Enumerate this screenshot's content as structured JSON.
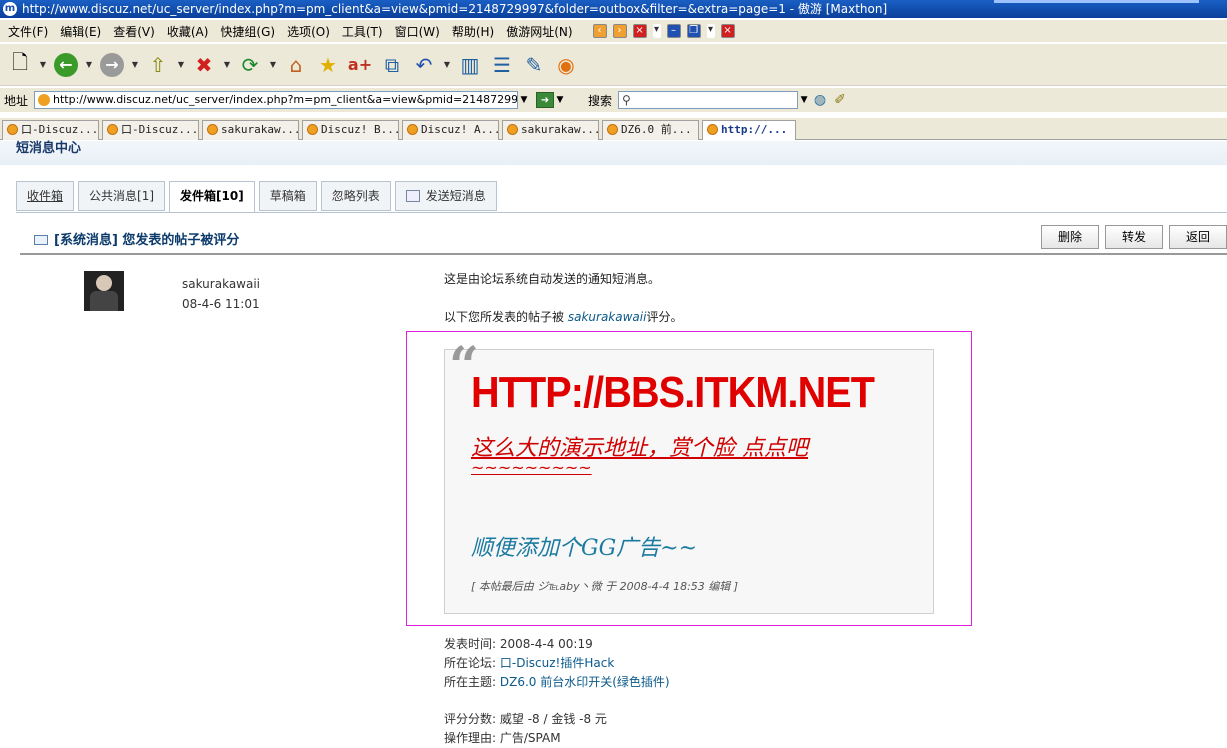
{
  "window": {
    "title": "http://www.discuz.net/uc_server/index.php?m=pm_client&a=view&pmid=2148729997&folder=outbox&filter=&extra=page=1 - 傲游 [Maxthon]"
  },
  "menu": {
    "items": [
      "文件(F)",
      "编辑(E)",
      "查看(V)",
      "收藏(A)",
      "快捷组(G)",
      "选项(O)",
      "工具(T)",
      "窗口(W)",
      "帮助(H)",
      "傲游网址(N)"
    ]
  },
  "addressbar": {
    "label": "地址",
    "url": "http://www.discuz.net/uc_server/index.php?m=pm_client&a=view&pmid=2148729997&folder",
    "search_label": "搜索"
  },
  "browser_tabs": [
    {
      "label": "口-Discuz..."
    },
    {
      "label": "口-Discuz..."
    },
    {
      "label": "sakurakaw..."
    },
    {
      "label": "Discuz! B..."
    },
    {
      "label": "Discuz! A..."
    },
    {
      "label": "sakurakaw..."
    },
    {
      "label": "DZ6.0 前..."
    },
    {
      "label": "http://..."
    }
  ],
  "page": {
    "center_title": "短消息中心",
    "tabs": [
      {
        "label": "收件箱"
      },
      {
        "label": "公共消息[1]"
      },
      {
        "label": "发件箱[10]"
      },
      {
        "label": "草稿箱"
      },
      {
        "label": "忽略列表"
      },
      {
        "label": "发送短消息"
      }
    ],
    "message_title": "[系统消息] 您发表的帖子被评分",
    "actions": {
      "delete": "删除",
      "forward": "转发",
      "back": "返回"
    },
    "sender": {
      "name": "sakurakawaii",
      "time": "08-4-6 11:01"
    },
    "body": {
      "line1": "这是由论坛系统自动发送的通知短消息。",
      "line2_prefix": "以下您所发表的帖子被",
      "line2_user": "sakurakawaii",
      "line2_suffix": "评分。"
    },
    "quote": {
      "big_url": "HTTP://BBS.ITKM.NET",
      "red_line": "这么大的演示地址，赏个脸 点点吧",
      "tilde": "~~~~~~~~~",
      "blue_line": "顺便添加个GG广告~~",
      "edit_note": "[ 本帖最后由 ジ℡aby丶微 于 2008-4-4 18:53 编辑 ]"
    },
    "meta": {
      "post_time_label": "发表时间:",
      "post_time": "2008-4-4 00:19",
      "forum_label": "所在论坛:",
      "forum": "口-Discuz!插件Hack",
      "thread_label": "所在主题:",
      "thread": "DZ6.0 前台水印开关(绿色插件)",
      "score_label": "评分分数:",
      "score": "威望 -8 / 金钱 -8 元",
      "reason_label": "操作理由:",
      "reason": "广告/SPAM"
    }
  }
}
